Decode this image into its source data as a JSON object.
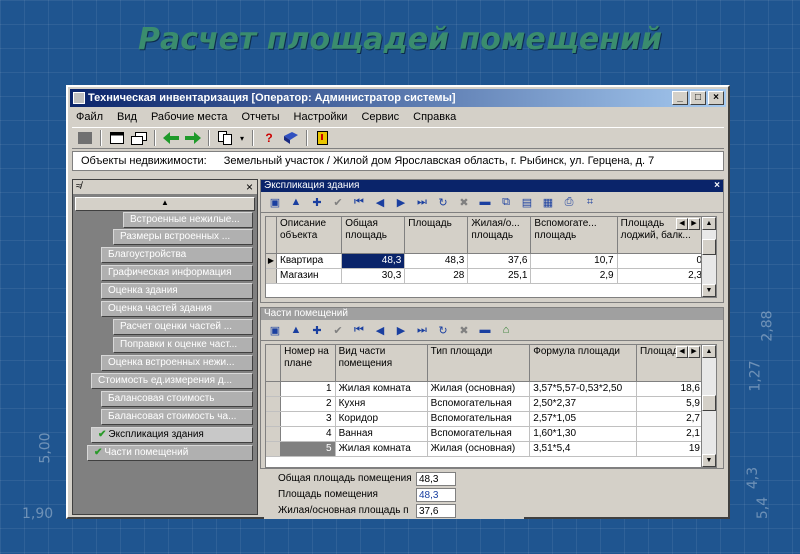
{
  "slide": {
    "title": "Расчет площадей помещений",
    "bg_numbers": [
      "2,88",
      "1,27",
      "5,00",
      "1,90",
      "4,3",
      "5,4"
    ]
  },
  "window": {
    "title": "Техническая инвентаризация [Оператор: Администратор системы]",
    "controls": {
      "minimize": "_",
      "maximize": "□",
      "close": "×"
    }
  },
  "menu": [
    "Файл",
    "Вид",
    "Рабочие места",
    "Отчеты",
    "Настройки",
    "Сервис",
    "Справка"
  ],
  "toolbar": {
    "icons": [
      "grid-icon",
      "window-icon",
      "windows-icon",
      "back-arrow-icon",
      "forward-arrow-icon",
      "copy-icon",
      "help-icon",
      "book-icon",
      "exit-icon"
    ]
  },
  "pathbar": {
    "label": "Объекты недвижимости:",
    "path": "Земельный участок / Жилой дом  Ярославская область, г. Рыбинск, ул. Герцена, д. 7"
  },
  "tree": {
    "header_icon": "≉",
    "close": "×",
    "items": [
      "Встроенные нежилые...",
      "Размеры встроенных ...",
      "Благоустройства",
      "Графическая информация",
      "Оценка здания",
      "Оценка частей здания",
      "Расчет оценки частей ...",
      "Поправки к оценке част...",
      "Оценка встроенных нежи...",
      "Стоимость ед.измерения д...",
      "Балансовая стоимость",
      "Балансовая стоимость ча...",
      "Экспликация здания",
      "Части помещений"
    ]
  },
  "explication": {
    "title": "Экспликация здания",
    "close": "×",
    "columns": [
      "Описание объекта",
      "Общая площадь",
      "Площадь",
      "Жилая/о... площадь",
      "Вспомогате... площадь",
      "Площадь лоджий, балк..."
    ],
    "rows": [
      {
        "indicator": "▶",
        "cells": [
          "Квартира",
          "48,3",
          "48,3",
          "37,6",
          "10,7",
          "0"
        ]
      },
      {
        "indicator": "",
        "cells": [
          "Магазин",
          "30,3",
          "28",
          "25,1",
          "2,9",
          "2,3"
        ]
      }
    ]
  },
  "rooms": {
    "title": "Части помещений",
    "columns": [
      "Номер на плане",
      "Вид части помещения",
      "Тип площади",
      "Формула площади",
      "Площадь"
    ],
    "rows": [
      {
        "cells": [
          "1",
          "Жилая комната",
          "Жилая (основная)",
          "3,57*5,57-0,53*2,50",
          "18,6"
        ]
      },
      {
        "cells": [
          "2",
          "Кухня",
          "Вспомогательная",
          "2,50*2,37",
          "5,9"
        ]
      },
      {
        "cells": [
          "3",
          "Коридор",
          "Вспомогательная",
          "2,57*1,05",
          "2,7"
        ]
      },
      {
        "cells": [
          "4",
          "Ванная",
          "Вспомогательная",
          "1,60*1,30",
          "2,1"
        ]
      },
      {
        "cells": [
          "5",
          "Жилая комната",
          "Жилая (основная)",
          "3,51*5,4",
          "19"
        ]
      }
    ]
  },
  "summary": [
    {
      "label": "Общая площадь помещения",
      "value": "48,3"
    },
    {
      "label": "Площадь помещения",
      "value": "48,3"
    },
    {
      "label": "Жилая/основная площадь п",
      "value": "37,6"
    }
  ],
  "colors": {
    "titlebar": "#0a246a",
    "selection": "#0a246a",
    "check": "#2a9a2a",
    "slide_title": "#3a8c6e"
  }
}
